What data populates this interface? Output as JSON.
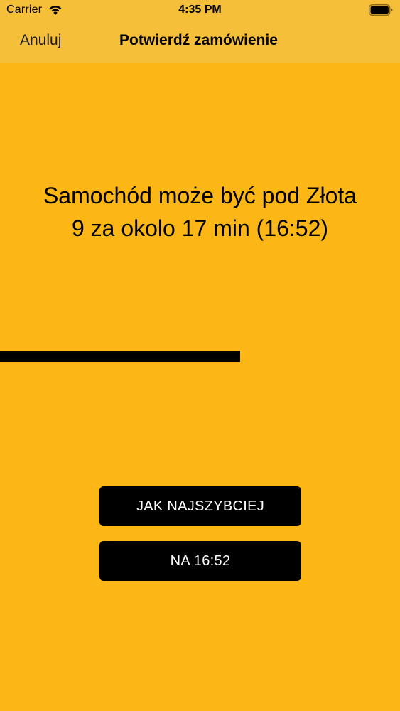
{
  "status_bar": {
    "carrier": "Carrier",
    "time": "4:35 PM",
    "wifi_icon": "wifi-icon",
    "battery_icon": "battery-icon"
  },
  "nav": {
    "cancel_label": "Anuluj",
    "title": "Potwierdź zamówienie"
  },
  "message": {
    "line1": "Samochód może być pod Złota",
    "line2": "9 za okolo 17 min (16:52)"
  },
  "progress": {
    "fraction": 0.6
  },
  "buttons": {
    "asap_label": "JAK NAJSZYBCIEJ",
    "scheduled_label": "NA 16:52"
  },
  "colors": {
    "background": "#FCB716",
    "bar": "#F6BF3A",
    "button": "#000000",
    "button_text": "#FFFFFF"
  }
}
